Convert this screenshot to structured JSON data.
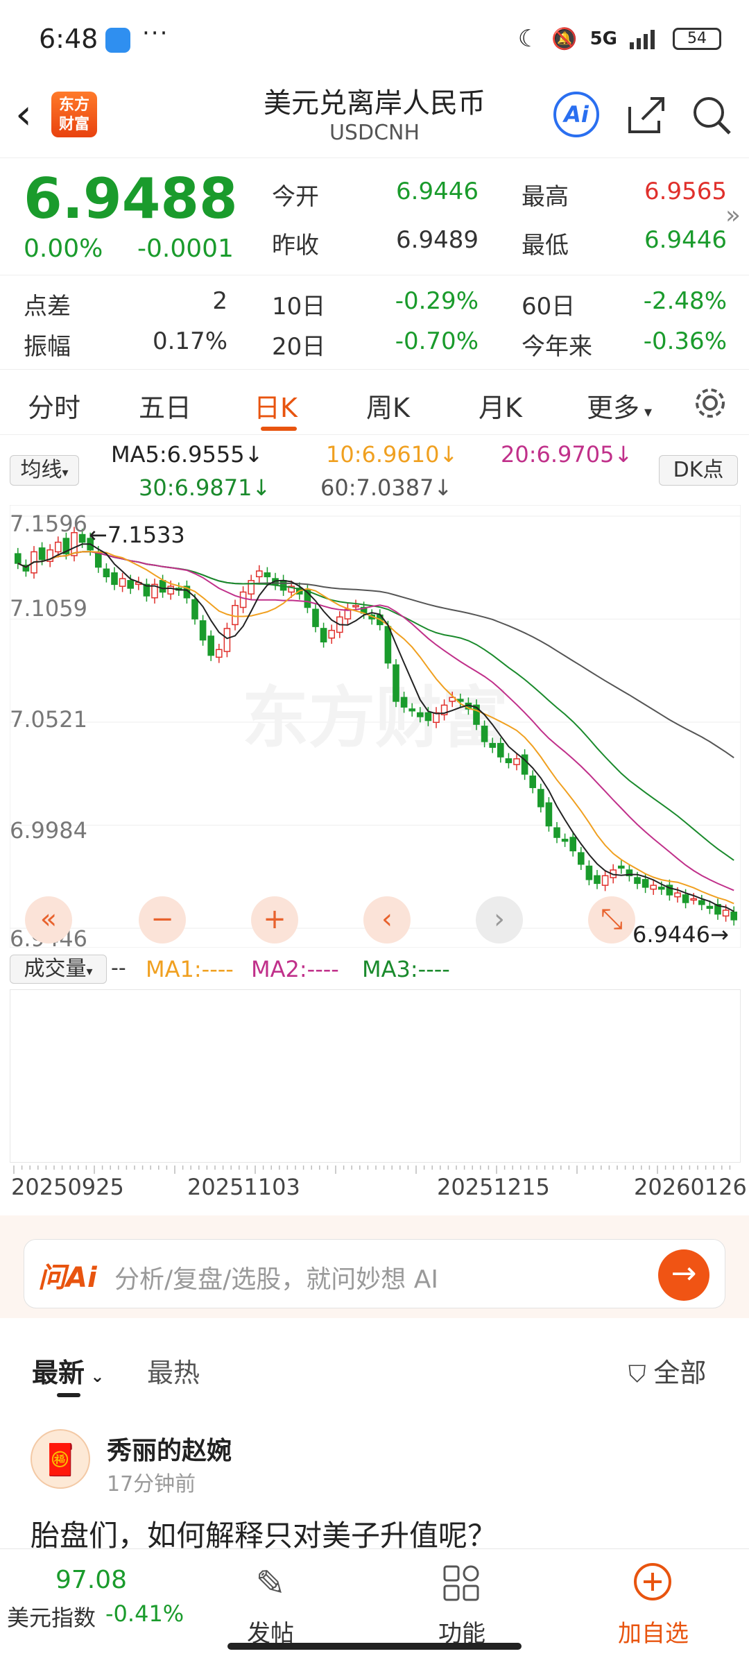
{
  "status": {
    "time": "6:48",
    "dots": "···",
    "network": "5G",
    "battery": "54"
  },
  "header": {
    "back_glyph": "‹",
    "logo_text_1": "东方",
    "logo_text_2": "财富",
    "title": "美元兑离岸人民币",
    "code": "USDCNH",
    "ai_label": "Ai"
  },
  "quote": {
    "price": "6.9488",
    "pct": "0.00%",
    "change": "-0.0001",
    "open_label": "今开",
    "open": "6.9446",
    "high_label": "最高",
    "high": "6.9565",
    "prev_label": "昨收",
    "prev": "6.9489",
    "low_label": "最低",
    "low": "6.9446",
    "spread_label": "点差",
    "spread": "2",
    "d10_label": "10日",
    "d10": "-0.29%",
    "d60_label": "60日",
    "d60": "-2.48%",
    "amp_label": "振幅",
    "amp": "0.17%",
    "d20_label": "20日",
    "d20": "-0.70%",
    "ytd_label": "今年来",
    "ytd": "-0.36%",
    "expand_glyph": "»"
  },
  "tabs": [
    "分时",
    "五日",
    "日K",
    "周K",
    "月K",
    "更多"
  ],
  "ma_legend": {
    "selector": "均线",
    "ma5": "MA5:6.9555↓",
    "ma10": "10:6.9610↓",
    "ma20": "20:6.9705↓",
    "ma30": "30:6.9871↓",
    "ma60": "60:7.0387↓",
    "dk": "DK点"
  },
  "volume_legend": {
    "selector": "成交量",
    "dash": "--",
    "ma1": "MA1:----",
    "ma2": "MA2:----",
    "ma3": "MA3:----"
  },
  "dates": [
    "20250925",
    "20251103",
    "20251215",
    "20260126"
  ],
  "ai_bar": {
    "logo": "问Ai",
    "placeholder": "分析/复盘/选股，就问妙想 AI",
    "go": "→"
  },
  "feed": {
    "tab_latest": "最新",
    "tab_hot": "最热",
    "filter": "全部",
    "post": {
      "author": "秀丽的赵婉",
      "time": "17分钟前",
      "text": "胎盘们，如何解释只对美子升值呢？"
    }
  },
  "bottom_nav": {
    "index_value": "97.08",
    "index_name": "美元指数",
    "index_change": "-0.41%",
    "post": "发帖",
    "func": "功能",
    "watch": "加自选"
  },
  "chart_data": {
    "type": "candlestick",
    "y_ticks": [
      7.1596,
      7.1059,
      7.0521,
      6.9984,
      6.9446
    ],
    "ylim": [
      6.9446,
      7.1596
    ],
    "x_ticks": [
      "20250925",
      "20251103",
      "20251215",
      "20260126"
    ],
    "annotations": {
      "high_label": "7.1533",
      "low_label": "6.9446"
    },
    "watermark": "东方财富",
    "close": [
      7.135,
      7.131,
      7.141,
      7.137,
      7.142,
      7.146,
      7.14,
      7.151,
      7.146,
      7.142,
      7.133,
      7.128,
      7.124,
      7.127,
      7.122,
      7.125,
      7.118,
      7.124,
      7.12,
      7.123,
      7.121,
      7.117,
      7.106,
      7.095,
      7.087,
      7.09,
      7.101,
      7.113,
      7.12,
      7.126,
      7.131,
      7.128,
      7.124,
      7.121,
      7.123,
      7.119,
      7.112,
      7.102,
      7.094,
      7.1,
      7.107,
      7.111,
      7.113,
      7.109,
      7.106,
      7.103,
      7.083,
      7.063,
      7.06,
      7.058,
      7.055,
      7.053,
      7.057,
      7.061,
      7.065,
      7.063,
      7.059,
      7.051,
      7.042,
      7.039,
      7.034,
      7.031,
      7.033,
      7.025,
      7.018,
      7.008,
      6.998,
      6.992,
      6.99,
      6.985,
      6.978,
      6.97,
      6.968,
      6.972,
      6.975,
      6.976,
      6.972,
      6.968,
      6.966,
      6.967,
      6.965,
      6.962,
      6.963,
      6.958,
      6.96,
      6.957,
      6.955,
      6.952,
      6.954,
      6.949
    ],
    "ma5_end": 6.9555,
    "ma10_end": 6.961,
    "ma20_end": 6.9705,
    "ma30_end": 6.9871,
    "ma60_end": 7.0387,
    "colors": {
      "up": "#e0302c",
      "down": "#1a9b2c",
      "ma5": "#222222",
      "ma10": "#f0a020",
      "ma20": "#c0308a",
      "ma30": "#1a8a2c",
      "ma60": "#555555"
    }
  }
}
